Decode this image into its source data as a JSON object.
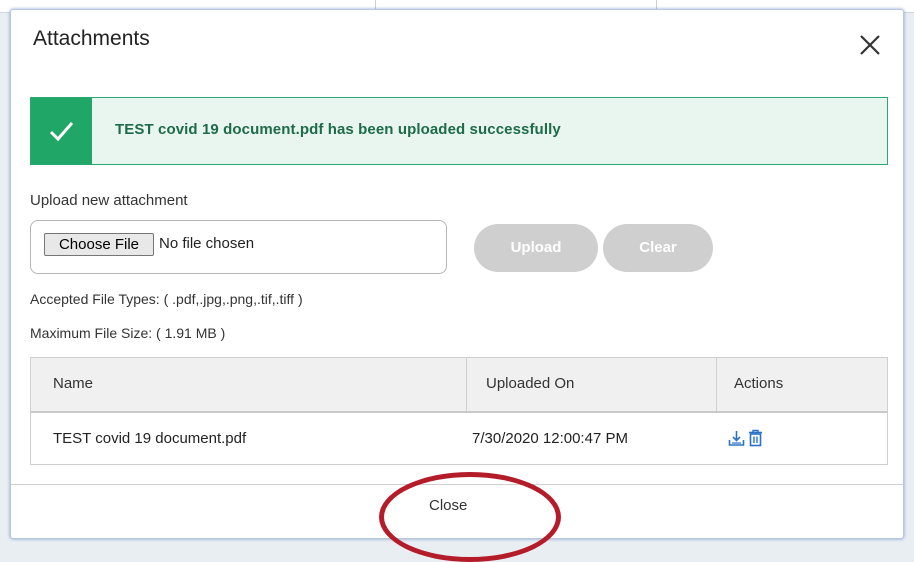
{
  "dialog": {
    "title": "Attachments",
    "close_icon": "close-icon"
  },
  "alert": {
    "icon": "checkmark-icon",
    "message": "TEST covid 19 document.pdf has been uploaded successfully",
    "color": "#20a667"
  },
  "upload": {
    "label": "Upload new attachment",
    "choose_file_label": "Choose File",
    "no_file_text": "No file chosen",
    "upload_button": "Upload",
    "clear_button": "Clear",
    "accepted_types": "Accepted File Types: ( .pdf,.jpg,.png,.tif,.tiff )",
    "max_size": "Maximum File Size: ( 1.91 MB )"
  },
  "table": {
    "columns": [
      "Name",
      "Uploaded On",
      "Actions"
    ],
    "rows": [
      {
        "name": "TEST covid 19 document.pdf",
        "uploaded_on": "7/30/2020 12:00:47 PM",
        "actions": [
          "download-icon",
          "delete-icon"
        ]
      }
    ]
  },
  "footer": {
    "close_label": "Close",
    "highlight_color": "#b41c2a"
  }
}
